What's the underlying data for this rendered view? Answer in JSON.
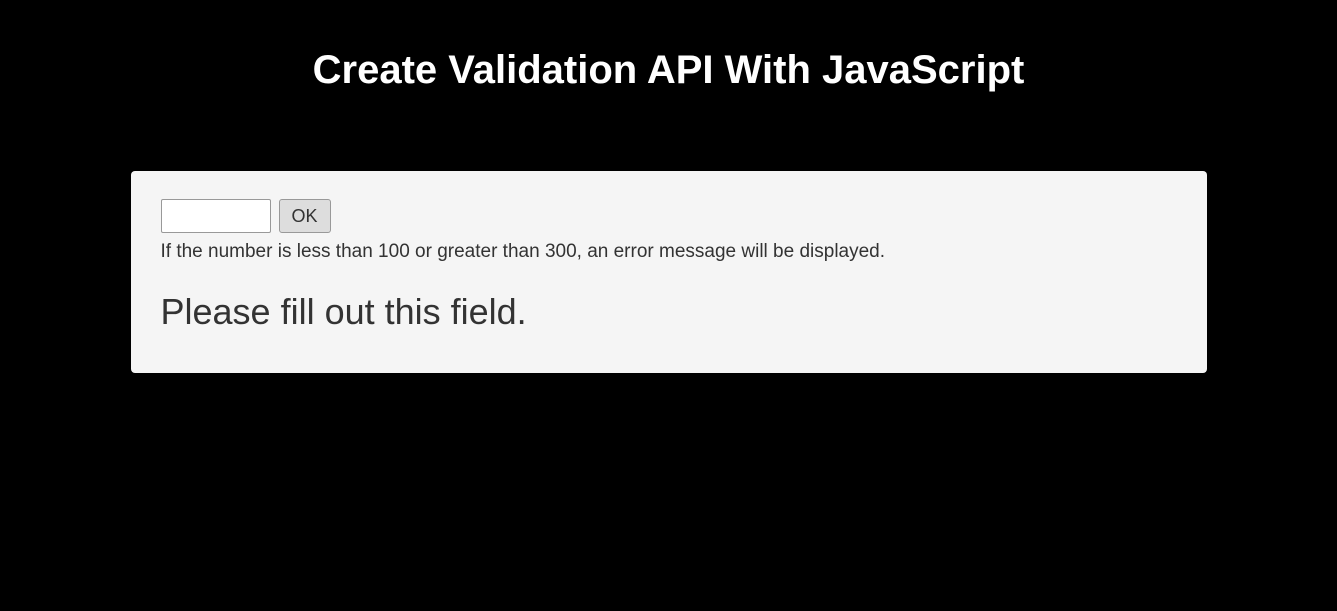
{
  "title": "Create Validation API With JavaScript",
  "form": {
    "input_value": "",
    "ok_label": "OK",
    "help_text": "If the number is less than 100 or greater than 300, an error message will be displayed.",
    "validation_message": "Please fill out this field."
  }
}
